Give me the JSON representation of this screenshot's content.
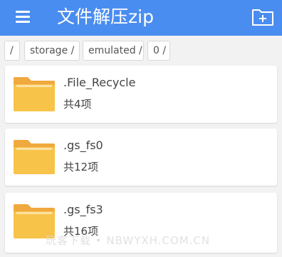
{
  "appbar": {
    "title": "文件解压zip",
    "color": "#4a8df0",
    "menu_icon": "hamburger-menu-icon",
    "new_folder_icon": "new-folder-plus-icon"
  },
  "breadcrumb": [
    "/",
    "storage /",
    "emulated /",
    "0 /"
  ],
  "folders": [
    {
      "name": ".File_Recycle",
      "count": "共4项"
    },
    {
      "name": ".gs_fs0",
      "count": "共12项"
    },
    {
      "name": ".gs_fs3",
      "count": "共16项"
    }
  ],
  "folder_icon": {
    "name": "folder-icon",
    "color": "#f8c349"
  },
  "watermark": "玩客下载 • NBWYXH.COM.CN"
}
